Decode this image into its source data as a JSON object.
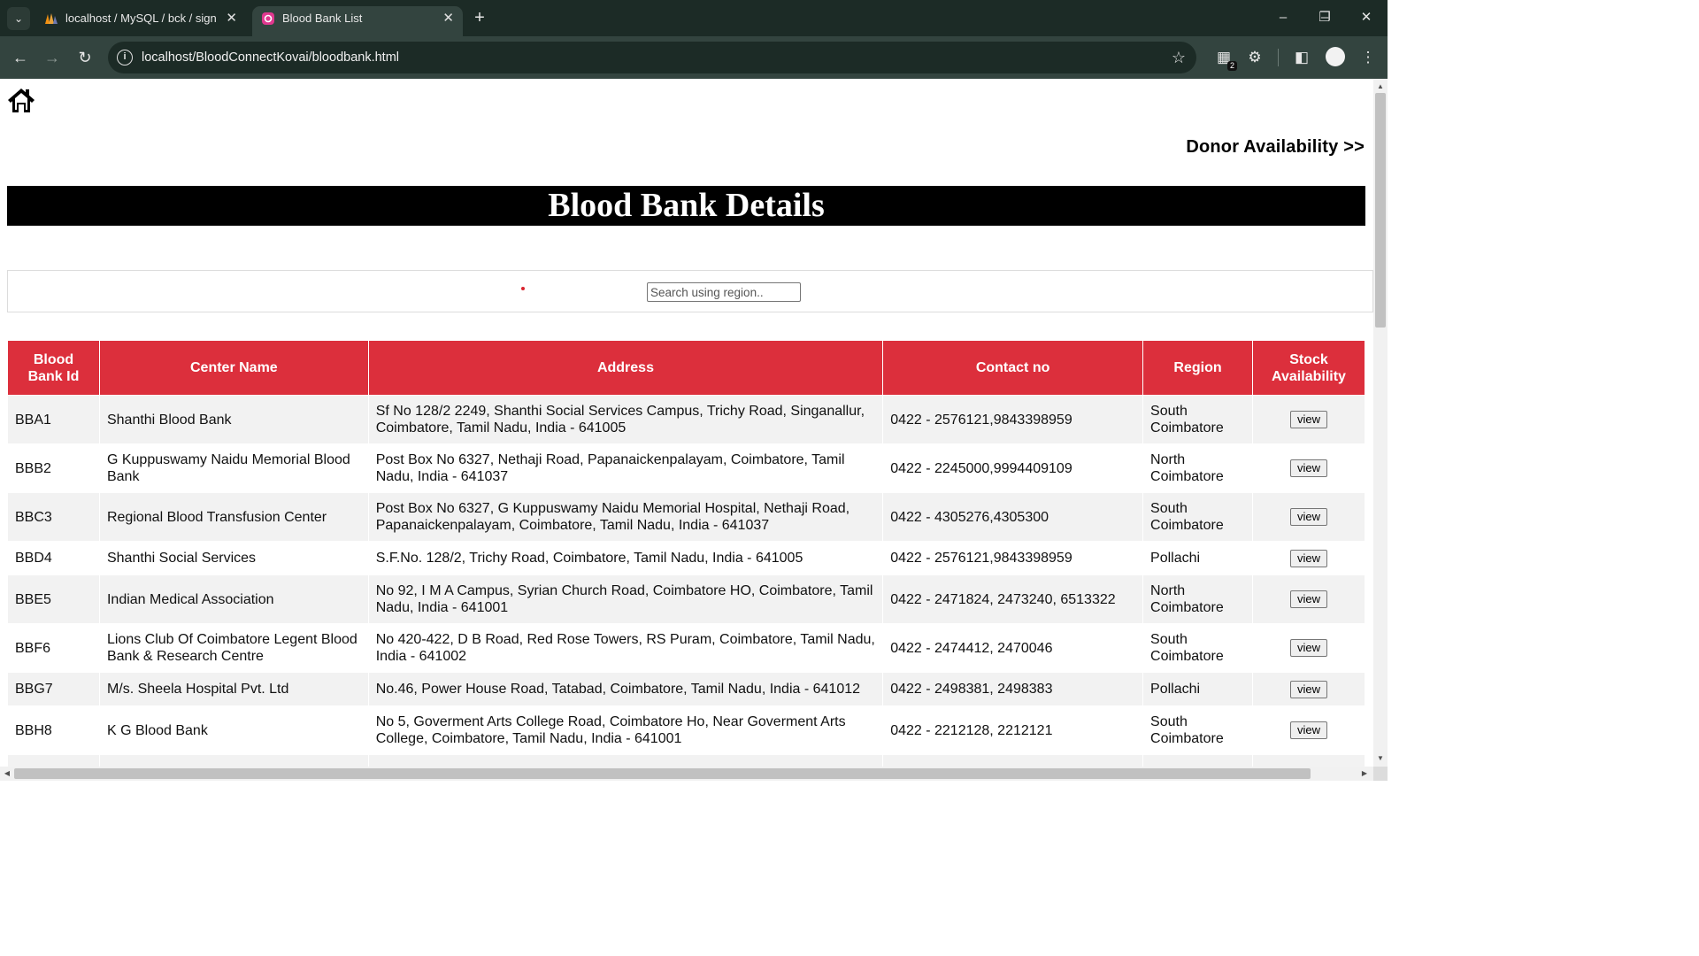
{
  "browser": {
    "tabs": [
      {
        "title": "localhost / MySQL / bck / signup",
        "active": false,
        "icon": "phpmyadmin-icon"
      },
      {
        "title": "Blood Bank List",
        "active": true,
        "icon": "page-favicon-icon"
      }
    ],
    "url": "localhost/BloodConnectKovai/bloodbank.html",
    "extension_badge": "2"
  },
  "page": {
    "donor_link": "Donor Availability >>",
    "banner_title": "Blood Bank Details",
    "search": {
      "placeholder": "Search using region..",
      "value": ""
    },
    "table": {
      "headers": [
        "Blood Bank Id",
        "Center Name",
        "Address",
        "Contact no",
        "Region",
        "Stock Availability"
      ],
      "view_label": "view",
      "rows": [
        {
          "id": "BBA1",
          "center": "Shanthi Blood Bank",
          "address": "Sf No 128/2 2249, Shanthi Social Services Campus, Trichy Road, Singanallur, Coimbatore, Tamil Nadu, India - 641005",
          "contact": "0422 - 2576121,9843398959",
          "region": "South Coimbatore"
        },
        {
          "id": "BBB2",
          "center": "G Kuppuswamy Naidu Memorial Blood Bank",
          "address": "Post Box No 6327, Nethaji Road, Papanaickenpalayam, Coimbatore, Tamil Nadu, India - 641037",
          "contact": "0422 - 2245000,9994409109",
          "region": "North Coimbatore"
        },
        {
          "id": "BBC3",
          "center": "Regional Blood Transfusion Center",
          "address": "Post Box No 6327, G Kuppuswamy Naidu Memorial Hospital, Nethaji Road, Papanaickenpalayam, Coimbatore, Tamil Nadu, India - 641037",
          "contact": "0422 - 4305276,4305300",
          "region": "South Coimbatore"
        },
        {
          "id": "BBD4",
          "center": "Shanthi Social Services",
          "address": "S.F.No. 128/2, Trichy Road, Coimbatore, Tamil Nadu, India - 641005",
          "contact": "0422 - 2576121,9843398959",
          "region": "Pollachi"
        },
        {
          "id": "BBE5",
          "center": "Indian Medical Association",
          "address": "No 92, I M A Campus, Syrian Church Road, Coimbatore HO, Coimbatore, Tamil Nadu, India - 641001",
          "contact": "0422 - 2471824, 2473240, 6513322",
          "region": "North Coimbatore"
        },
        {
          "id": "BBF6",
          "center": "Lions Club Of Coimbatore Legent Blood Bank & Research Centre",
          "address": "No 420-422, D B Road, Red Rose Towers, RS Puram, Coimbatore, Tamil Nadu, India - 641002",
          "contact": "0422 - 2474412, 2470046",
          "region": "South Coimbatore"
        },
        {
          "id": "BBG7",
          "center": "M/s. Sheela Hospital Pvt. Ltd",
          "address": "No.46, Power House Road, Tatabad, Coimbatore, Tamil Nadu, India - 641012",
          "contact": "0422 - 2498381, 2498383",
          "region": "Pollachi"
        },
        {
          "id": "BBH8",
          "center": "K G Blood Bank",
          "address": "No 5, Goverment Arts College Road, Coimbatore Ho, Near Goverment Arts College, Coimbatore, Tamil Nadu, India - 641001",
          "contact": "0422 - 2212128, 2212121",
          "region": "South Coimbatore"
        }
      ]
    }
  },
  "colors": {
    "header_red": "#dc2f3c",
    "banner_black": "#000000",
    "chrome_dark": "#1c2b26",
    "chrome_toolbar": "#33443f"
  }
}
